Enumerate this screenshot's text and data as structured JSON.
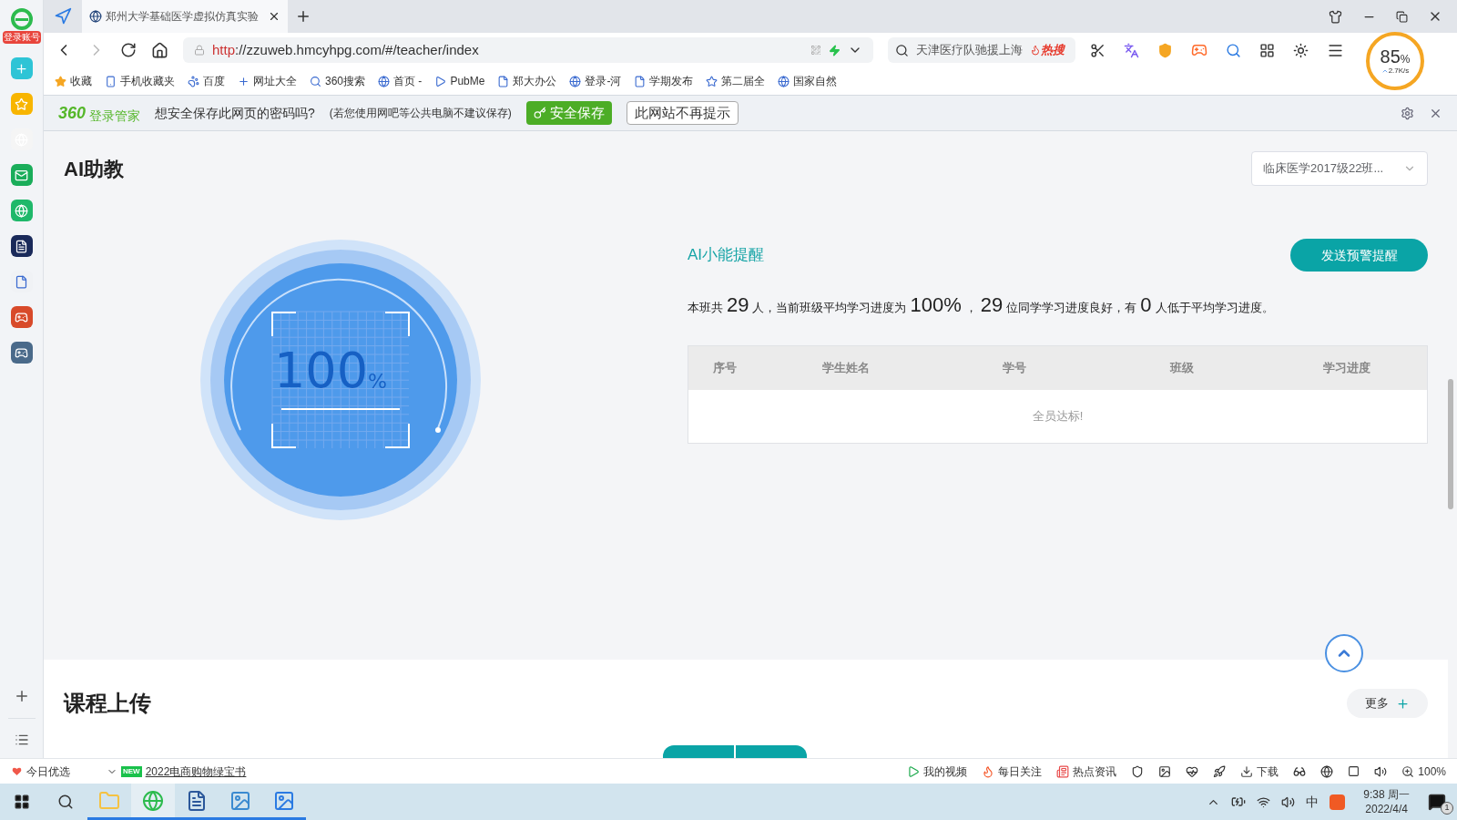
{
  "browser": {
    "sidebar": {
      "login_label": "登录账号"
    },
    "tab": {
      "title": "郑州大学基础医学虚拟仿真实验"
    },
    "address": {
      "scheme": "http",
      "rest": "://zzuweb.hmcyhpg.com/#/teacher/index"
    },
    "hot_search": {
      "text": "天津医疗队驰援上海",
      "badge": "热搜"
    },
    "speed": {
      "percent": "85",
      "unit": "%",
      "rate": "2.7K/s"
    },
    "bookmarks": [
      "收藏",
      "手机收藏夹",
      "百度",
      "网址大全",
      "360搜索",
      "首页 -",
      "PubMe",
      "郑大办公",
      "登录-河",
      "学期发布",
      "第二届全",
      "国家自然"
    ],
    "password_bar": {
      "brand": "360",
      "brand_label": "登录管家",
      "question": "想安全保存此网页的密码吗?",
      "note": "(若您使用网吧等公共电脑不建议保存)",
      "save": "安全保存",
      "never": "此网站不再提示"
    }
  },
  "page": {
    "title": "AI助教",
    "class_select": "临床医学2017级22班...",
    "gauge": {
      "value": "100",
      "unit": "%"
    },
    "alert_title": "AI小能提醒",
    "send_button": "发送预警提醒",
    "summary": [
      {
        "kind": "plain",
        "text": "本班共"
      },
      {
        "kind": "number",
        "text": "29"
      },
      {
        "kind": "plain",
        "text": "人，当前班级平均学习进度为"
      },
      {
        "kind": "number",
        "text": "100%"
      },
      {
        "kind": "plain",
        "text": "，"
      },
      {
        "kind": "number",
        "text": "29"
      },
      {
        "kind": "plain",
        "text": "位同学学习进度良好，有"
      },
      {
        "kind": "number",
        "text": "0"
      },
      {
        "kind": "plain",
        "text": "人低于平均学习进度。"
      }
    ],
    "table": {
      "columns": [
        "序号",
        "学生姓名",
        "学号",
        "班级",
        "学习进度"
      ],
      "empty": "全员达标!"
    },
    "section2": {
      "title": "课程上传",
      "more": "更多"
    }
  },
  "status_bar": {
    "daily": "今日优选",
    "promo_badge": "NEW",
    "promo": "2022电商购物绿宝书",
    "items": [
      "我的视频",
      "每日关注",
      "热点资讯",
      "下载",
      "100%"
    ]
  },
  "taskbar": {
    "time": "9:38 周一",
    "date": "2022/4/4",
    "ime": "中",
    "notifications": "1"
  }
}
